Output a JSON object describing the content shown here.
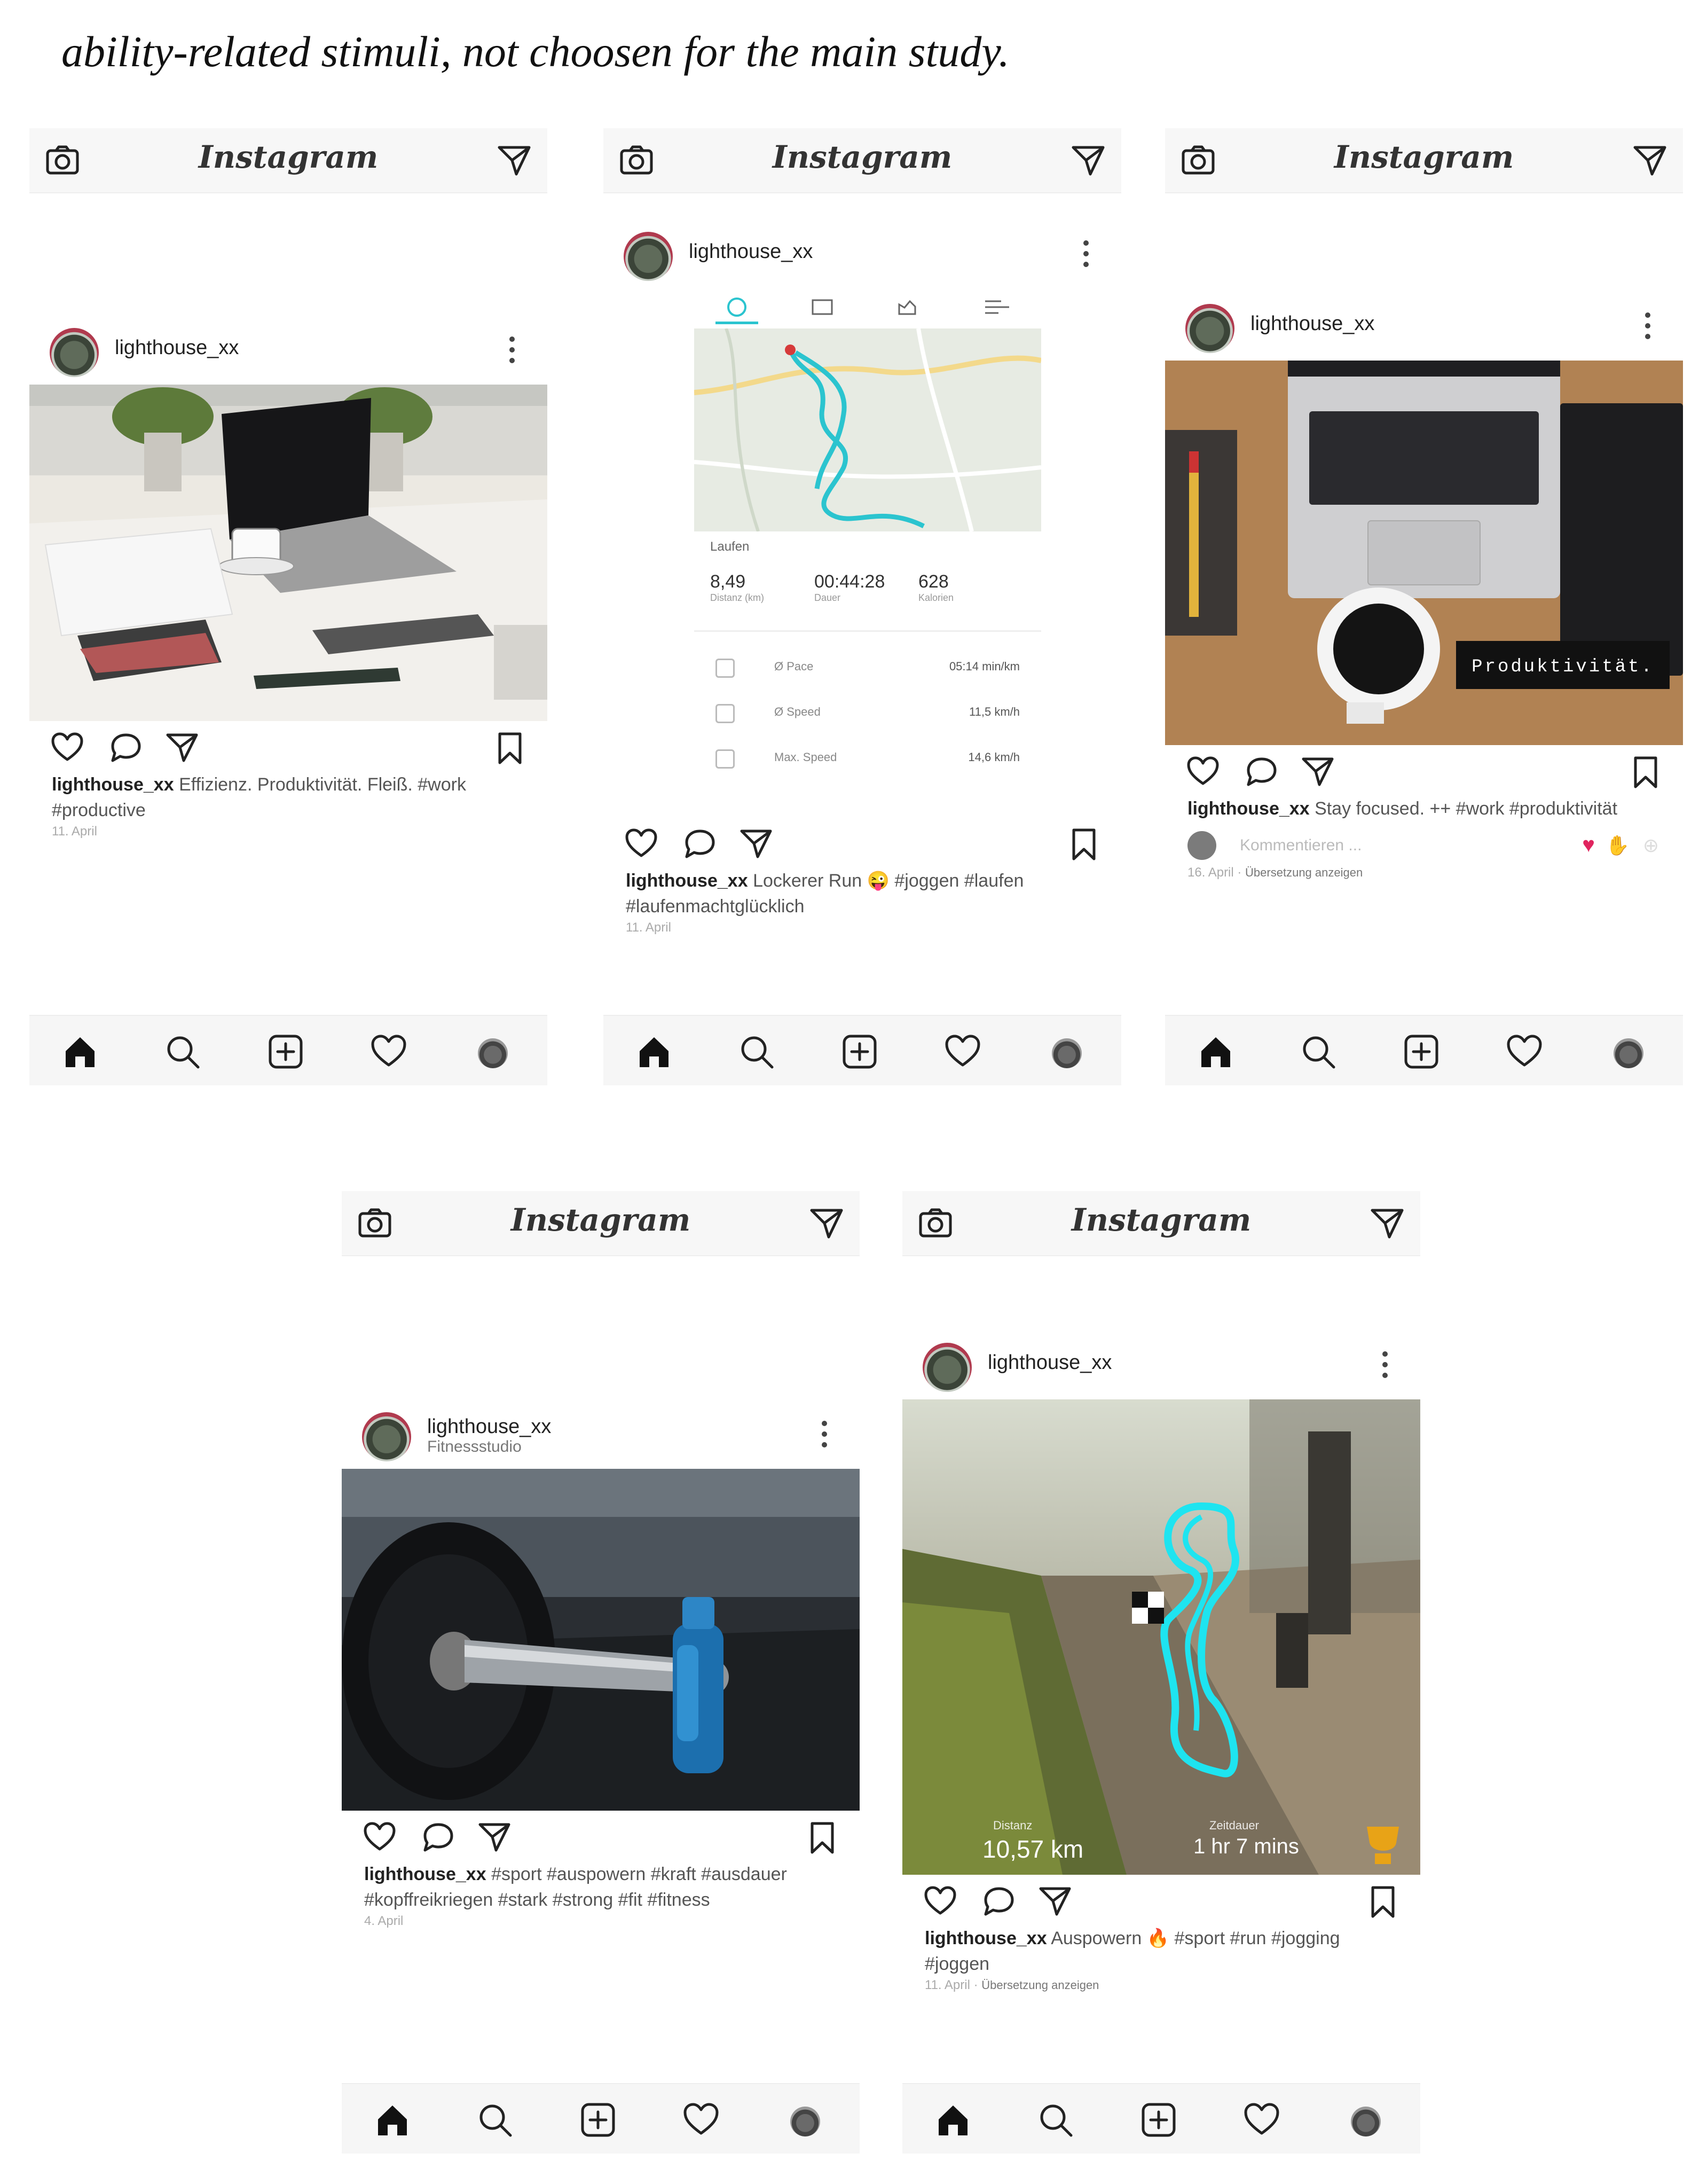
{
  "page_caption": "ability-related stimuli, not choosen for the main study.",
  "app": {
    "wordmark": "Instagram",
    "header_icons": [
      "camera-icon",
      "direct-message-icon"
    ],
    "nav_icons": [
      "home-icon",
      "search-icon",
      "add-post-icon",
      "activity-heart-icon",
      "profile-avatar-icon"
    ]
  },
  "posts": [
    {
      "username": "lighthouse_xx",
      "caption_user": "lighthouse_xx",
      "caption": "Effizienz. Produktivität. Fleiß. #work #productive",
      "timestamp": "11. April",
      "image": "laptop-desk-photo"
    },
    {
      "username": "lighthouse_xx",
      "caption_user": "lighthouse_xx",
      "caption": "Lockerer Run 😜 #joggen #laufen #laufenmachtglücklich",
      "timestamp": "11. April",
      "image": "running-route-map",
      "activity": {
        "type": "Laufen",
        "distance": "8,49",
        "distance_label": "Distanz (km)",
        "duration": "00:44:28",
        "duration_label": "Dauer",
        "calories": "628",
        "calories_label": "Kalorien",
        "rows": [
          {
            "label": "Ø Pace",
            "value": "05:14 min/km"
          },
          {
            "label": "Ø Speed",
            "value": "11,5 km/h"
          },
          {
            "label": "Max. Speed",
            "value": "14,6 km/h"
          }
        ]
      }
    },
    {
      "username": "lighthouse_xx",
      "caption_user": "lighthouse_xx",
      "caption": "Stay focused. ++ #work #produktivität",
      "comment_placeholder": "Kommentieren ...",
      "timestamp": "16. April",
      "translation": "Übersetzung anzeigen",
      "image": "laptop-coffee-topdown-photo",
      "image_overlay_text": "Produktivität."
    },
    {
      "username": "lighthouse_xx",
      "location": "Fitnessstudio",
      "caption_user": "lighthouse_xx",
      "caption": "#sport #auspowern #kraft #ausdauer #kopffreikriegen #stark #strong #fit #fitness",
      "timestamp": "4. April",
      "image": "barbell-gym-photo"
    },
    {
      "username": "lighthouse_xx",
      "caption_user": "lighthouse_xx",
      "caption": "Auspowern 🔥 #sport #run #jogging #joggen",
      "timestamp": "11. April",
      "translation": "Übersetzung anzeigen",
      "image": "running-path-route-photo",
      "overlay": {
        "distance_label": "Distanz",
        "distance": "10,57 km",
        "time_label": "Zeitdauer",
        "time": "1 hr 7 mins"
      }
    }
  ],
  "colors": {
    "route": "#2bc4cf",
    "like_red": "#e0245e"
  }
}
